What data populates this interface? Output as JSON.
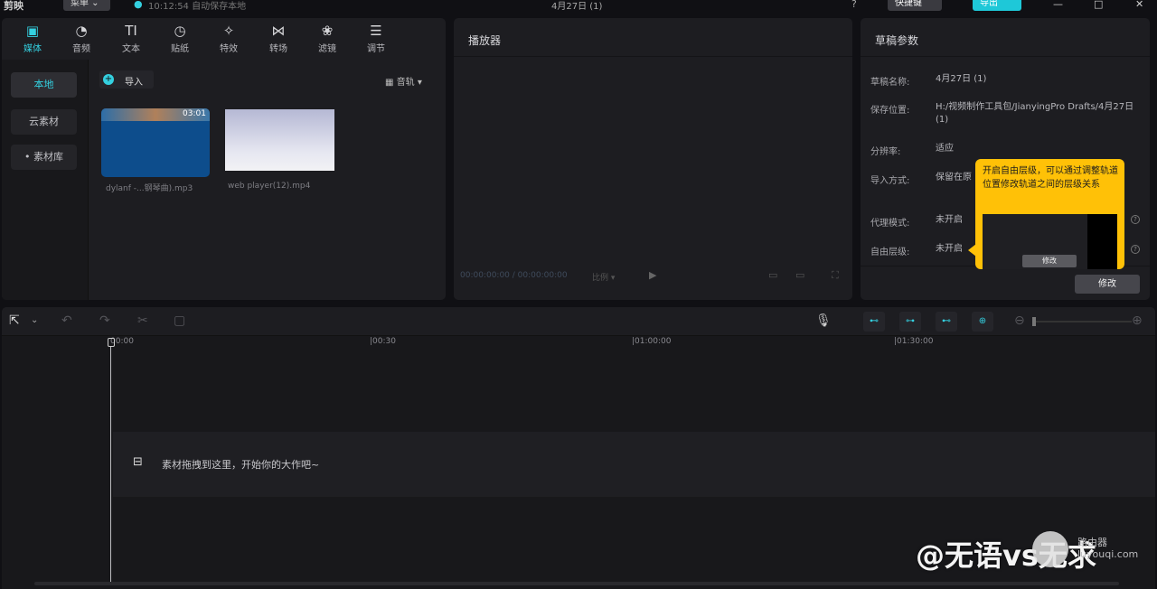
{
  "topbar": {
    "app_name": "剪映",
    "menu_label": "菜单",
    "autosave_text": "10:12:54 自动保存本地",
    "project_title": "4月27日 (1)",
    "shortcut_label": "快捷键",
    "export_label": "导出"
  },
  "media_panel": {
    "tabs": [
      {
        "label": "媒体",
        "icon": "media-icon"
      },
      {
        "label": "音频",
        "icon": "audio-icon"
      },
      {
        "label": "文本",
        "icon": "text-icon"
      },
      {
        "label": "贴纸",
        "icon": "sticker-icon"
      },
      {
        "label": "特效",
        "icon": "effects-icon"
      },
      {
        "label": "转场",
        "icon": "transition-icon"
      },
      {
        "label": "滤镜",
        "icon": "filter-icon"
      },
      {
        "label": "调节",
        "icon": "adjust-icon"
      }
    ],
    "sidebar": [
      "本地",
      "云素材",
      "• 素材库"
    ],
    "import_label": "导入",
    "sort_label": "音轨",
    "clips": [
      {
        "duration": "03:01",
        "name": "dylanf -...钢琴曲).mp3"
      },
      {
        "duration": "",
        "name": "web player(12).mp4"
      }
    ]
  },
  "player_panel": {
    "title": "播放器",
    "timecode": "00:00:00:00 / 00:00:00:00",
    "ratio_label": "比例"
  },
  "draft_panel": {
    "title": "草稿参数",
    "rows": [
      {
        "label": "草稿名称:",
        "value": "4月27日 (1)"
      },
      {
        "label": "保存位置:",
        "value": "H:/视频制作工具包/JianyingPro Drafts/4月27日 (1)"
      },
      {
        "label": "分辨率:",
        "value": "适应"
      },
      {
        "label": "导入方式:",
        "value": "保留在原"
      },
      {
        "label": "代理模式:",
        "value": "未开启"
      },
      {
        "label": "自由层级:",
        "value": "未开启"
      }
    ],
    "edit_label": "修改",
    "tooltip": {
      "text": "开启自由层级，可以通过调整轨道位置修改轨道之间的层级关系",
      "mini_button": "修改"
    }
  },
  "timeline": {
    "ruler": [
      "00:00",
      "|00:30",
      "|01:00:00",
      "|01:30:00"
    ],
    "drop_hint": "素材拖拽到这里，开始你的大作吧~"
  },
  "watermark": {
    "text": "@无语vs无求",
    "site_line1": "路由器",
    "site_line2": "luyouqi.com"
  },
  "colors": {
    "accent": "#34d0e0",
    "tooltip": "#ffc107",
    "export": "#1ec8d8"
  }
}
